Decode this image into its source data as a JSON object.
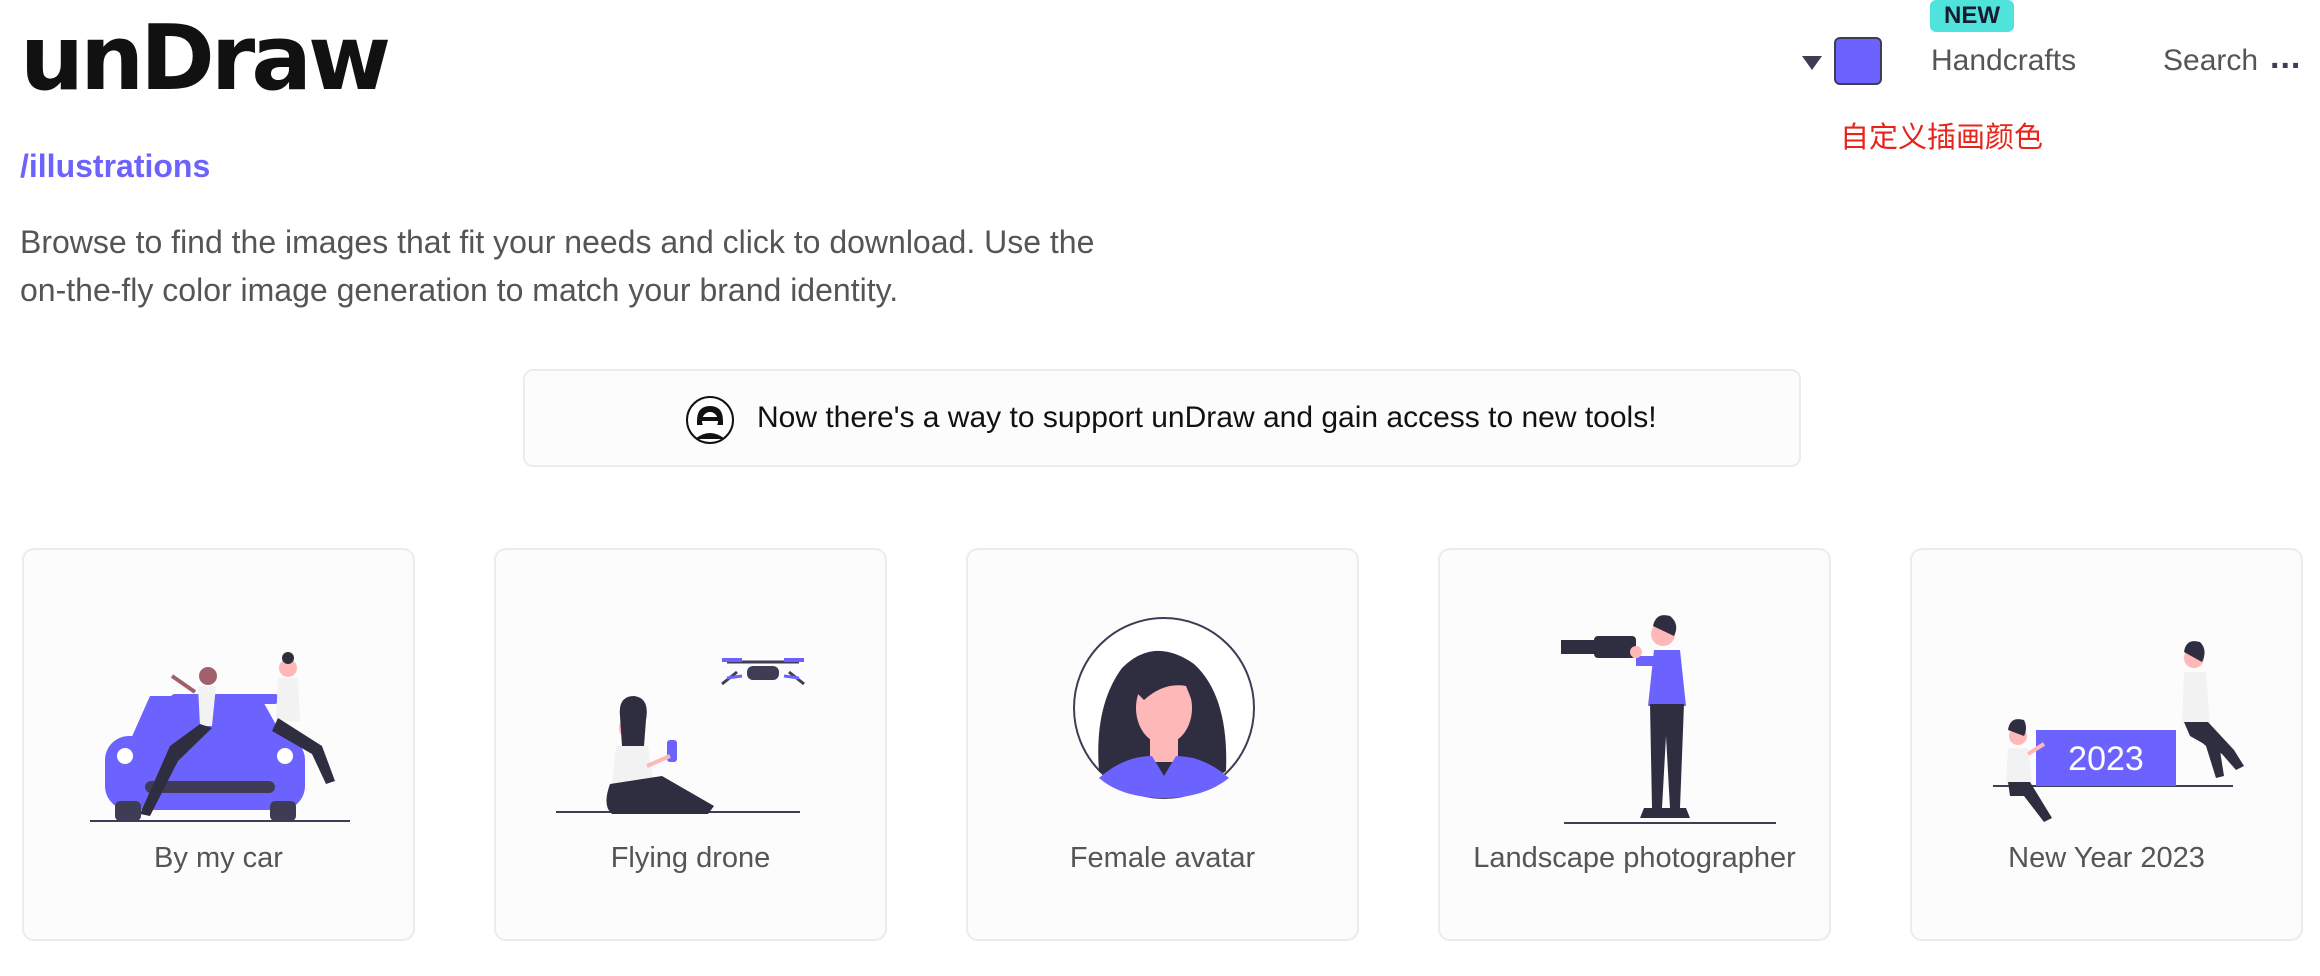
{
  "header": {
    "logo": "unDraw",
    "path": "/illustrations",
    "intro": "Browse to find the images that fit your needs and click to download. Use the on-the-fly color image generation to match your brand identity."
  },
  "nav": {
    "badge": "NEW",
    "handcrafts": "Handcrafts",
    "search": "Search",
    "more": "...",
    "color_swatch": "#6c63ff"
  },
  "annotation": "自定义插画颜色",
  "banner": {
    "text": "Now there's a way to support unDraw and gain access to new tools!"
  },
  "cards": [
    {
      "title": "By my car"
    },
    {
      "title": "Flying drone"
    },
    {
      "title": "Female avatar"
    },
    {
      "title": "Landscape photographer"
    },
    {
      "title": "New Year 2023",
      "illustration_text": "2023"
    }
  ],
  "colors": {
    "accent": "#6c63ff",
    "dark": "#3f3d56",
    "annotation_red": "#e8241a",
    "badge_teal": "#4fe3dc"
  }
}
